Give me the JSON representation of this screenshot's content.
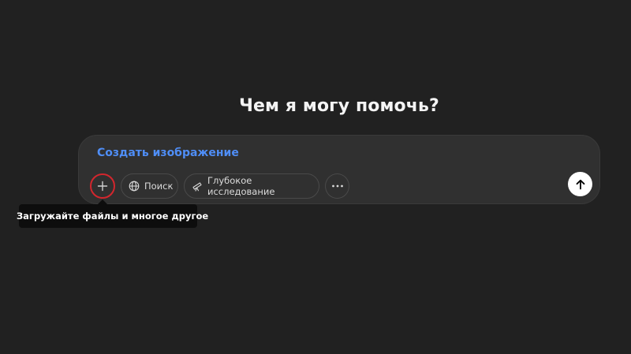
{
  "main": {
    "heading": "Чем я могу помочь?"
  },
  "composer": {
    "suggestion": "Создать изображение",
    "buttons": {
      "add_icon": "plus-icon",
      "search_label": "Поиск",
      "search_icon": "globe-icon",
      "research_label": "Глубокое исследование",
      "research_icon": "telescope-icon",
      "more_icon": "more-icon",
      "send_icon": "arrow-up-icon"
    }
  },
  "tooltip": {
    "text": "Загружайте файлы и многое другое"
  },
  "colors": {
    "background": "#212121",
    "composer": "#303030",
    "accent_link": "#4f8ef7",
    "highlight_ring": "#d3262d",
    "tooltip_bg": "#0d0d0d"
  }
}
